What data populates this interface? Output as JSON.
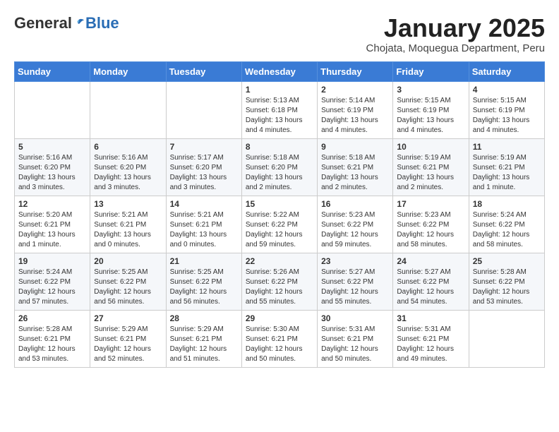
{
  "header": {
    "logo_general": "General",
    "logo_blue": "Blue",
    "month_title": "January 2025",
    "location": "Chojata, Moquegua Department, Peru"
  },
  "weekdays": [
    "Sunday",
    "Monday",
    "Tuesday",
    "Wednesday",
    "Thursday",
    "Friday",
    "Saturday"
  ],
  "weeks": [
    [
      {
        "day": "",
        "info": ""
      },
      {
        "day": "",
        "info": ""
      },
      {
        "day": "",
        "info": ""
      },
      {
        "day": "1",
        "info": "Sunrise: 5:13 AM\nSunset: 6:18 PM\nDaylight: 13 hours and 4 minutes."
      },
      {
        "day": "2",
        "info": "Sunrise: 5:14 AM\nSunset: 6:19 PM\nDaylight: 13 hours and 4 minutes."
      },
      {
        "day": "3",
        "info": "Sunrise: 5:15 AM\nSunset: 6:19 PM\nDaylight: 13 hours and 4 minutes."
      },
      {
        "day": "4",
        "info": "Sunrise: 5:15 AM\nSunset: 6:19 PM\nDaylight: 13 hours and 4 minutes."
      }
    ],
    [
      {
        "day": "5",
        "info": "Sunrise: 5:16 AM\nSunset: 6:20 PM\nDaylight: 13 hours and 3 minutes."
      },
      {
        "day": "6",
        "info": "Sunrise: 5:16 AM\nSunset: 6:20 PM\nDaylight: 13 hours and 3 minutes."
      },
      {
        "day": "7",
        "info": "Sunrise: 5:17 AM\nSunset: 6:20 PM\nDaylight: 13 hours and 3 minutes."
      },
      {
        "day": "8",
        "info": "Sunrise: 5:18 AM\nSunset: 6:20 PM\nDaylight: 13 hours and 2 minutes."
      },
      {
        "day": "9",
        "info": "Sunrise: 5:18 AM\nSunset: 6:21 PM\nDaylight: 13 hours and 2 minutes."
      },
      {
        "day": "10",
        "info": "Sunrise: 5:19 AM\nSunset: 6:21 PM\nDaylight: 13 hours and 2 minutes."
      },
      {
        "day": "11",
        "info": "Sunrise: 5:19 AM\nSunset: 6:21 PM\nDaylight: 13 hours and 1 minute."
      }
    ],
    [
      {
        "day": "12",
        "info": "Sunrise: 5:20 AM\nSunset: 6:21 PM\nDaylight: 13 hours and 1 minute."
      },
      {
        "day": "13",
        "info": "Sunrise: 5:21 AM\nSunset: 6:21 PM\nDaylight: 13 hours and 0 minutes."
      },
      {
        "day": "14",
        "info": "Sunrise: 5:21 AM\nSunset: 6:21 PM\nDaylight: 13 hours and 0 minutes."
      },
      {
        "day": "15",
        "info": "Sunrise: 5:22 AM\nSunset: 6:22 PM\nDaylight: 12 hours and 59 minutes."
      },
      {
        "day": "16",
        "info": "Sunrise: 5:23 AM\nSunset: 6:22 PM\nDaylight: 12 hours and 59 minutes."
      },
      {
        "day": "17",
        "info": "Sunrise: 5:23 AM\nSunset: 6:22 PM\nDaylight: 12 hours and 58 minutes."
      },
      {
        "day": "18",
        "info": "Sunrise: 5:24 AM\nSunset: 6:22 PM\nDaylight: 12 hours and 58 minutes."
      }
    ],
    [
      {
        "day": "19",
        "info": "Sunrise: 5:24 AM\nSunset: 6:22 PM\nDaylight: 12 hours and 57 minutes."
      },
      {
        "day": "20",
        "info": "Sunrise: 5:25 AM\nSunset: 6:22 PM\nDaylight: 12 hours and 56 minutes."
      },
      {
        "day": "21",
        "info": "Sunrise: 5:25 AM\nSunset: 6:22 PM\nDaylight: 12 hours and 56 minutes."
      },
      {
        "day": "22",
        "info": "Sunrise: 5:26 AM\nSunset: 6:22 PM\nDaylight: 12 hours and 55 minutes."
      },
      {
        "day": "23",
        "info": "Sunrise: 5:27 AM\nSunset: 6:22 PM\nDaylight: 12 hours and 55 minutes."
      },
      {
        "day": "24",
        "info": "Sunrise: 5:27 AM\nSunset: 6:22 PM\nDaylight: 12 hours and 54 minutes."
      },
      {
        "day": "25",
        "info": "Sunrise: 5:28 AM\nSunset: 6:22 PM\nDaylight: 12 hours and 53 minutes."
      }
    ],
    [
      {
        "day": "26",
        "info": "Sunrise: 5:28 AM\nSunset: 6:21 PM\nDaylight: 12 hours and 53 minutes."
      },
      {
        "day": "27",
        "info": "Sunrise: 5:29 AM\nSunset: 6:21 PM\nDaylight: 12 hours and 52 minutes."
      },
      {
        "day": "28",
        "info": "Sunrise: 5:29 AM\nSunset: 6:21 PM\nDaylight: 12 hours and 51 minutes."
      },
      {
        "day": "29",
        "info": "Sunrise: 5:30 AM\nSunset: 6:21 PM\nDaylight: 12 hours and 50 minutes."
      },
      {
        "day": "30",
        "info": "Sunrise: 5:31 AM\nSunset: 6:21 PM\nDaylight: 12 hours and 50 minutes."
      },
      {
        "day": "31",
        "info": "Sunrise: 5:31 AM\nSunset: 6:21 PM\nDaylight: 12 hours and 49 minutes."
      },
      {
        "day": "",
        "info": ""
      }
    ]
  ]
}
